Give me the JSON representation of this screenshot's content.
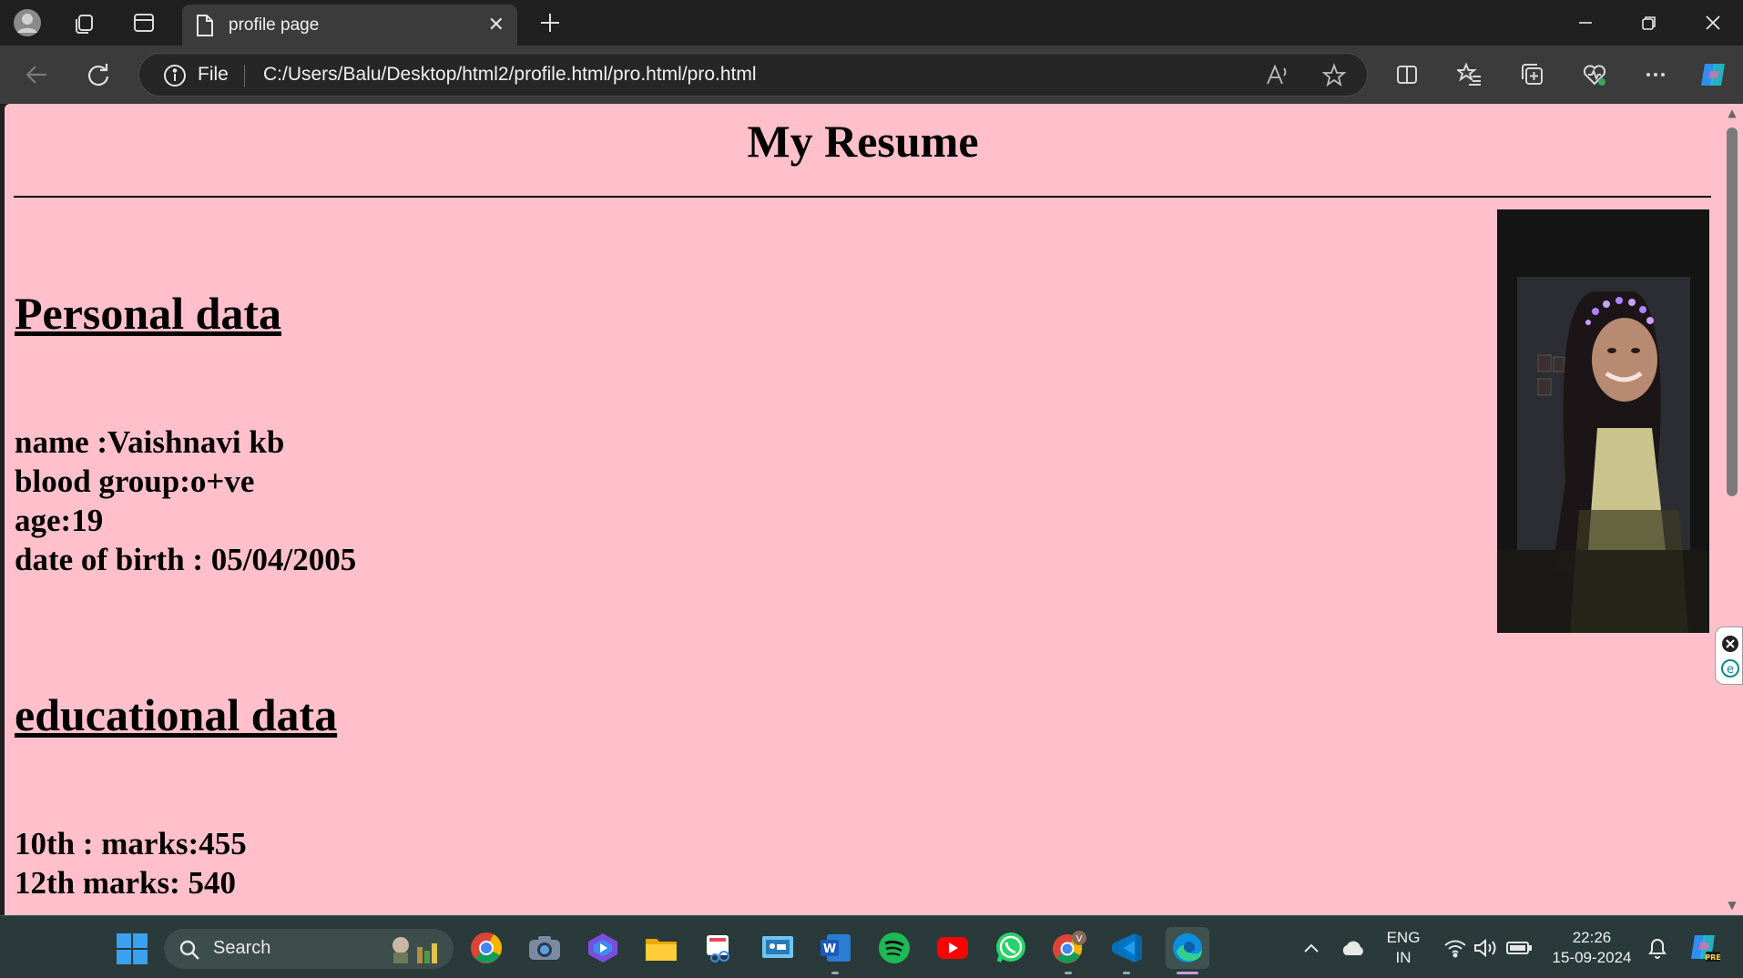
{
  "browser": {
    "tab_title": "profile page",
    "url_scheme_label": "File",
    "url": "C:/Users/Balu/Desktop/html2/profile.html/pro.html/pro.html"
  },
  "page": {
    "title": "My Resume",
    "personal_heading": "Personal data",
    "personal_lines": [
      "name :Vaishnavi kb",
      "blood group:o+ve",
      "age:19",
      "date of birth : 05/04/2005"
    ],
    "education_heading": "educational data",
    "education_lines": [
      "10th : marks:455",
      "12th marks: 540"
    ],
    "background_color": "#ffc0cb"
  },
  "taskbar": {
    "search_label": "Search",
    "language": "ENG",
    "region": "IN",
    "time": "22:26",
    "date": "15-09-2024"
  }
}
